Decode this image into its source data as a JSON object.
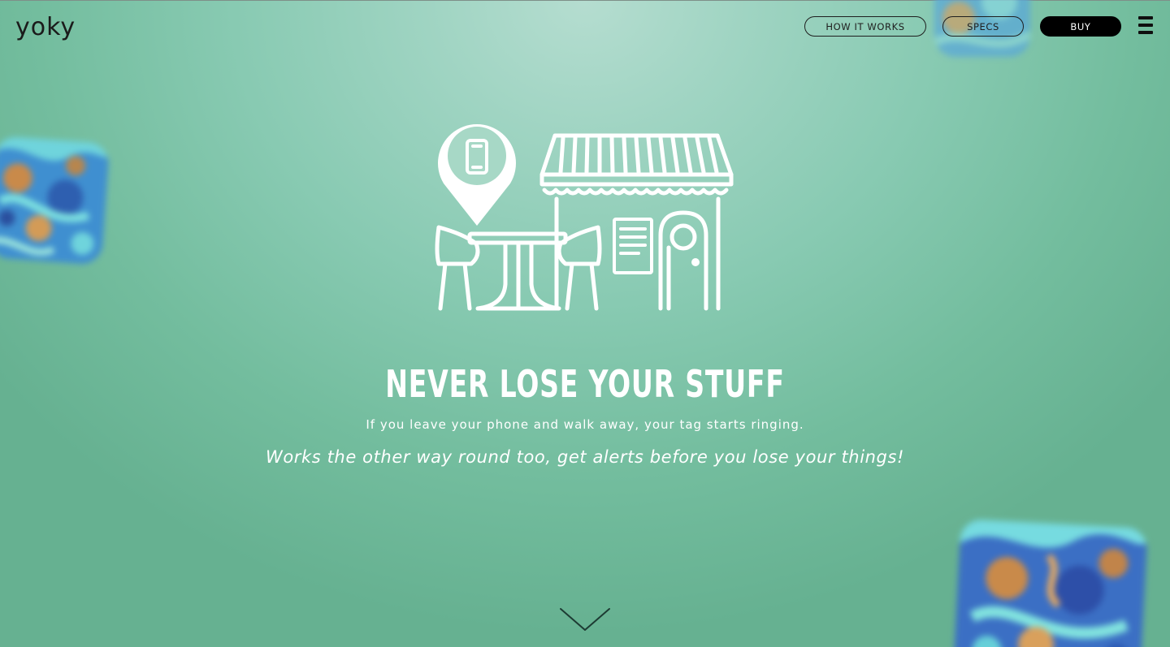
{
  "header": {
    "logo_text": "yoky",
    "nav": {
      "how_it_works": "HOW IT WORKS",
      "specs": "SPECS",
      "buy": "BUY"
    },
    "menu_icon": "hamburger-menu-icon"
  },
  "hero": {
    "illustration_icons": [
      "location-pin-icon",
      "phone-icon",
      "cafe-table-icon",
      "chair-icon",
      "storefront-awning-icon",
      "menu-board-icon",
      "door-icon"
    ],
    "headline": "NEVER LOSE YOUR STUFF",
    "line_1": "If you leave your phone and walk away, your tag starts ringing.",
    "line_2": "Works the other way round too, get alerts before you lose your things!",
    "scroll_icon": "chevron-down-icon"
  },
  "colors": {
    "background": "#73bd9e",
    "background_light": "#b5ddd0",
    "text": "#ffffff",
    "dark": "#000000"
  }
}
